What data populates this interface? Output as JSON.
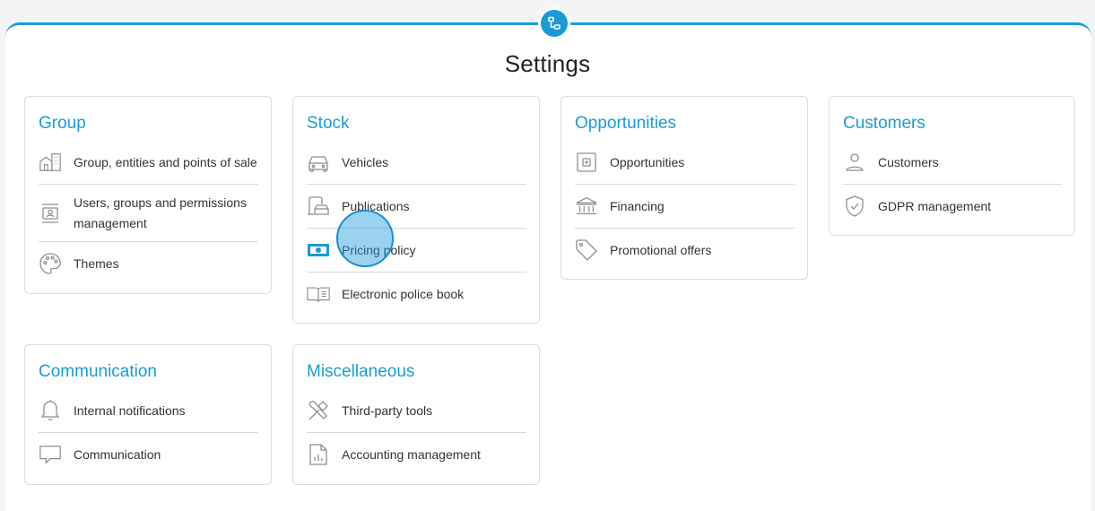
{
  "page_title": "Settings",
  "colors": {
    "accent": "#1a9bd7",
    "card_border": "#d9dde1",
    "text": "#333333"
  },
  "top_badge_icon": "network-icon",
  "cards": {
    "group": {
      "title": "Group",
      "items": [
        {
          "label": "Group, entities and points of sale",
          "icon": "building-icon"
        },
        {
          "label": "Users, groups and permissions management",
          "icon": "id-card-icon"
        },
        {
          "label": "Themes",
          "icon": "palette-icon"
        }
      ]
    },
    "stock": {
      "title": "Stock",
      "items": [
        {
          "label": "Vehicles",
          "icon": "car-icon"
        },
        {
          "label": "Publications",
          "icon": "publication-icon"
        },
        {
          "label": "Pricing policy",
          "icon": "banknote-icon"
        },
        {
          "label": "Electronic police book",
          "icon": "book-icon"
        }
      ]
    },
    "opportunities": {
      "title": "Opportunities",
      "items": [
        {
          "label": "Opportunities",
          "icon": "wallet-icon"
        },
        {
          "label": "Financing",
          "icon": "bank-icon"
        },
        {
          "label": "Promotional offers",
          "icon": "tag-icon"
        }
      ]
    },
    "customers": {
      "title": "Customers",
      "items": [
        {
          "label": "Customers",
          "icon": "user-icon"
        },
        {
          "label": "GDPR management",
          "icon": "shield-check-icon"
        }
      ]
    },
    "communication": {
      "title": "Communication",
      "items": [
        {
          "label": "Internal notifications",
          "icon": "bell-icon"
        },
        {
          "label": "Communication",
          "icon": "chat-bubble-icon"
        }
      ]
    },
    "miscellaneous": {
      "title": "Miscellaneous",
      "items": [
        {
          "label": "Third-party tools",
          "icon": "tools-icon"
        },
        {
          "label": "Accounting management",
          "icon": "report-icon"
        }
      ]
    }
  }
}
